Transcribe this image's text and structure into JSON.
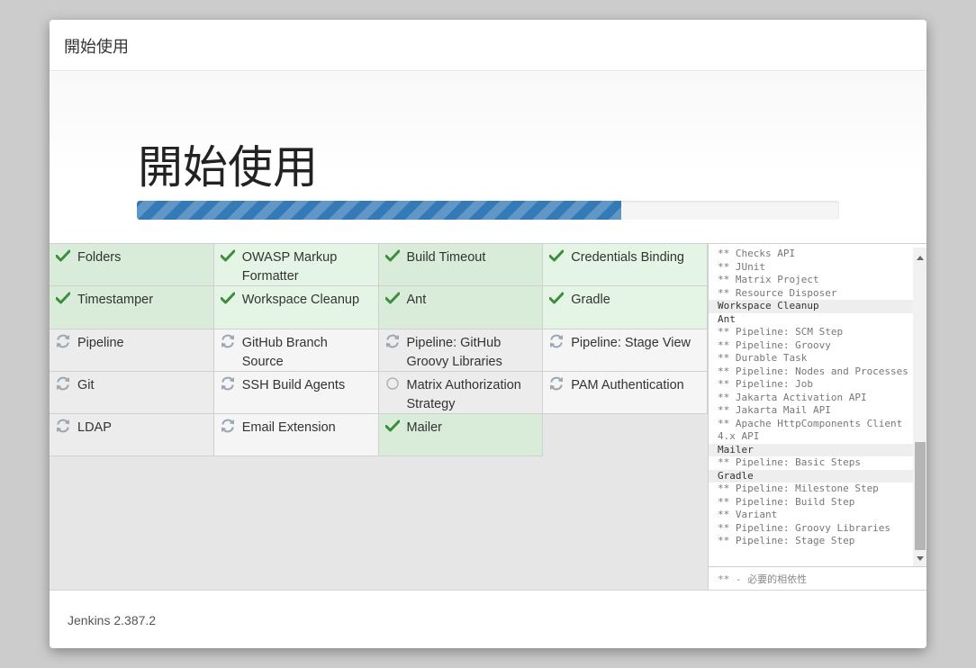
{
  "dialog": {
    "title": "開始使用"
  },
  "hero": {
    "title": "開始使用",
    "progress_percent": 69
  },
  "plugins": [
    {
      "name": "Folders",
      "status": "success",
      "icon": "check-icon"
    },
    {
      "name": "OWASP Markup Formatter",
      "status": "success",
      "icon": "check-icon"
    },
    {
      "name": "Build Timeout",
      "status": "success",
      "icon": "check-icon"
    },
    {
      "name": "Credentials Binding",
      "status": "success",
      "icon": "check-icon"
    },
    {
      "name": "Timestamper",
      "status": "success",
      "icon": "check-icon"
    },
    {
      "name": "Workspace Cleanup",
      "status": "success",
      "icon": "check-icon"
    },
    {
      "name": "Ant",
      "status": "success",
      "icon": "check-icon"
    },
    {
      "name": "Gradle",
      "status": "success",
      "icon": "check-icon"
    },
    {
      "name": "Pipeline",
      "status": "installing",
      "icon": "refresh-icon"
    },
    {
      "name": "GitHub Branch Source",
      "status": "installing",
      "icon": "refresh-icon"
    },
    {
      "name": "Pipeline: GitHub Groovy Libraries",
      "status": "installing",
      "icon": "refresh-icon"
    },
    {
      "name": "Pipeline: Stage View",
      "status": "installing",
      "icon": "refresh-icon"
    },
    {
      "name": "Git",
      "status": "installing",
      "icon": "refresh-icon"
    },
    {
      "name": "SSH Build Agents",
      "status": "installing",
      "icon": "refresh-icon"
    },
    {
      "name": "Matrix Authorization Strategy",
      "status": "pending",
      "icon": "circle-icon"
    },
    {
      "name": "PAM Authentication",
      "status": "installing",
      "icon": "refresh-icon"
    },
    {
      "name": "LDAP",
      "status": "installing",
      "icon": "refresh-icon"
    },
    {
      "name": "Email Extension",
      "status": "installing",
      "icon": "refresh-icon"
    },
    {
      "name": "Mailer",
      "status": "success",
      "icon": "check-icon"
    }
  ],
  "log": [
    {
      "text": "** Checks API",
      "kind": "dep"
    },
    {
      "text": "** JUnit",
      "kind": "dep"
    },
    {
      "text": "** Matrix Project",
      "kind": "dep"
    },
    {
      "text": "** Resource Disposer",
      "kind": "dep"
    },
    {
      "text": "Workspace Cleanup",
      "kind": "head"
    },
    {
      "text": "Ant",
      "kind": "plain"
    },
    {
      "text": "** Pipeline: SCM Step",
      "kind": "dep"
    },
    {
      "text": "** Pipeline: Groovy",
      "kind": "dep"
    },
    {
      "text": "** Durable Task",
      "kind": "dep"
    },
    {
      "text": "** Pipeline: Nodes and Processes",
      "kind": "dep"
    },
    {
      "text": "** Pipeline: Job",
      "kind": "dep"
    },
    {
      "text": "** Jakarta Activation API",
      "kind": "dep"
    },
    {
      "text": "** Jakarta Mail API",
      "kind": "dep"
    },
    {
      "text": "** Apache HttpComponents Client 4.x API",
      "kind": "dep"
    },
    {
      "text": "Mailer",
      "kind": "head"
    },
    {
      "text": "** Pipeline: Basic Steps",
      "kind": "dep"
    },
    {
      "text": "Gradle",
      "kind": "head"
    },
    {
      "text": "** Pipeline: Milestone Step",
      "kind": "dep"
    },
    {
      "text": "** Pipeline: Build Step",
      "kind": "dep"
    },
    {
      "text": "** Variant",
      "kind": "dep"
    },
    {
      "text": "** Pipeline: Groovy Libraries",
      "kind": "dep"
    },
    {
      "text": "** Pipeline: Stage Step",
      "kind": "dep"
    }
  ],
  "log_footer": "** - 必要的相依性",
  "footer": {
    "version": "Jenkins 2.387.2"
  },
  "colors": {
    "success_icon": "#3c8d3c",
    "installing_icon": "#9aa7b3",
    "progress": "#337ab7"
  }
}
